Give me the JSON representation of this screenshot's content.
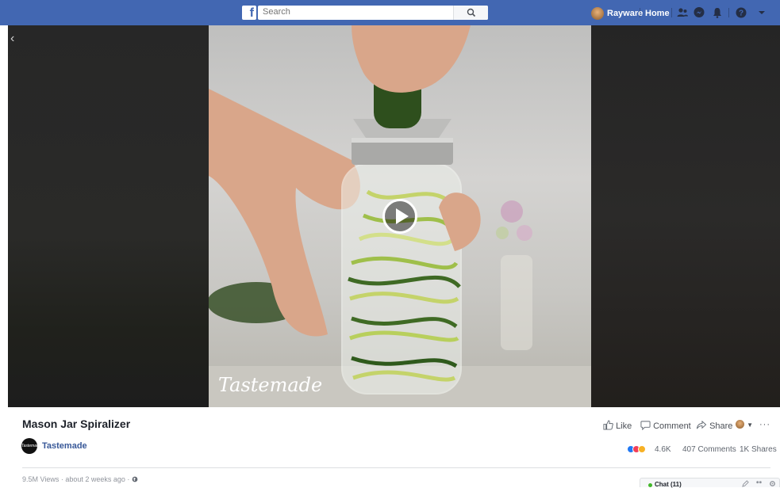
{
  "topbar": {
    "logo": "f",
    "search_placeholder": "Search",
    "user_name": "Rayware",
    "home_label": "Home",
    "bg_color": "#4267b2"
  },
  "viewer": {
    "watermark": "Tastemade"
  },
  "post": {
    "title": "Mason Jar Spiralizer",
    "page_name": "Tastemade",
    "page_avatar_text": "Tastemade",
    "actions": {
      "like": "Like",
      "comment": "Comment",
      "share": "Share"
    },
    "reaction_count": "4.6K",
    "comments": "407 Comments",
    "shares": "1K Shares",
    "meta": "9.5M Views · about 2 weeks ago ·"
  },
  "chat": {
    "label": "Chat (11)"
  },
  "icons": [
    "search-icon",
    "friends-icon",
    "messenger-icon",
    "notifications-icon",
    "help-icon",
    "dropdown-icon",
    "back-chevron-icon",
    "play-icon",
    "like-icon",
    "comment-icon",
    "share-icon",
    "globe-icon",
    "more-icon",
    "compose-icon",
    "settings-icon"
  ]
}
